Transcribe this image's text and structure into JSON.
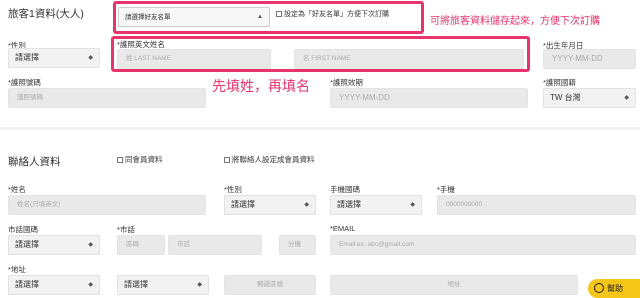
{
  "traveler": {
    "heading": "旅客1資料(大人)",
    "friend_select": "請選擇好友名單",
    "friend_checkbox": "設定為「好友名單」方便下次訂購",
    "friend_note": "可將旅客資料儲存起來，方便下次訂購",
    "gender_label": "*性別",
    "gender_value": "請選擇",
    "name_label": "*護照英文姓名",
    "last_name_placeholder": "姓 LAST NAME",
    "first_name_placeholder": "名 FIRST NAME",
    "dob_label": "*出生年月日",
    "dob_placeholder": "YYYY-MM-DD",
    "passport_label": "*護照號碼",
    "passport_placeholder": "護照號碼",
    "name_note": "先填姓，再填名",
    "expiry_label": "*護照效期",
    "expiry_placeholder": "YYYY-MM-DD",
    "nationality_label": "*護照國籍",
    "nationality_value": "TW 台灣"
  },
  "contact": {
    "heading": "聯絡人資料",
    "same_member_checkbox": "同會員資料",
    "set_member_checkbox": "將聯絡人設定成會員資料",
    "name_label": "*姓名",
    "name_placeholder": "姓名(只填英文)",
    "gender_label": "*性別",
    "gender_value": "請選擇",
    "mobile_country_label": "手機國碼",
    "mobile_country_value": "請選擇",
    "mobile_label": "*手機",
    "mobile_placeholder": "0000000000",
    "tel_country_label": "市話國碼",
    "tel_country_value": "請選擇",
    "tel_label": "*市話",
    "area_placeholder": "區碼",
    "tel_placeholder": "市話",
    "ext_placeholder": "分機",
    "email_label": "*EMAIL",
    "email_placeholder": "Email ex. abc@gmail.com",
    "address_label": "*地址",
    "city_value": "請選擇",
    "district_value": "請選擇",
    "zip_placeholder": "郵遞區號",
    "address_placeholder": "地址"
  },
  "chat": {
    "label": "幫助"
  },
  "colors": {
    "accent": "#e8336b",
    "chat": "#f5c518"
  }
}
